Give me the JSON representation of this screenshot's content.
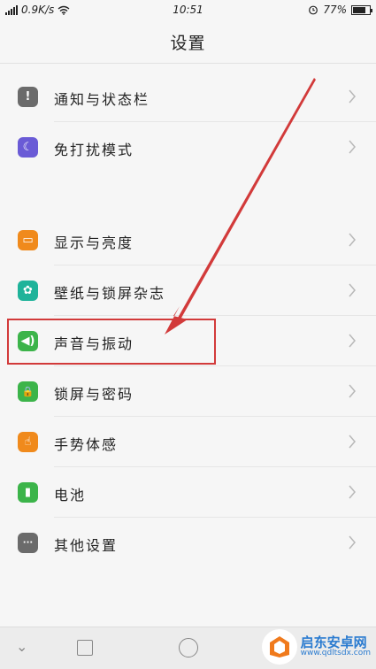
{
  "status_bar": {
    "speed": "0.9K/s",
    "time": "10:51",
    "battery_percent": "77%",
    "battery_level": 0.77,
    "icons": [
      "signal-icon",
      "wifi-icon",
      "alarm-icon",
      "battery-icon"
    ]
  },
  "header": {
    "title": "设置"
  },
  "groups": [
    {
      "items": [
        {
          "label": "通知与状态栏",
          "icon": "exclamation-icon",
          "color": "#6b6b6b",
          "glyph": "!"
        },
        {
          "label": "免打扰模式",
          "icon": "moon-icon",
          "color": "#6a5bd6",
          "glyph": "☾"
        }
      ]
    },
    {
      "items": [
        {
          "label": "显示与亮度",
          "icon": "display-icon",
          "color": "#f08a1c",
          "glyph": "▭"
        },
        {
          "label": "壁纸与锁屏杂志",
          "icon": "flower-icon",
          "color": "#1fb39a",
          "glyph": "✿"
        },
        {
          "label": "声音与振动",
          "icon": "speaker-icon",
          "color": "#3cb44a",
          "glyph": "◀)"
        },
        {
          "label": "锁屏与密码",
          "icon": "lock-icon",
          "color": "#3cb44a",
          "glyph": "🔒"
        },
        {
          "label": "手势体感",
          "icon": "hand-icon",
          "color": "#f08a1c",
          "glyph": "☝"
        },
        {
          "label": "电池",
          "icon": "battery-small-icon",
          "color": "#3cb44a",
          "glyph": "▮"
        },
        {
          "label": "其他设置",
          "icon": "more-icon",
          "color": "#6b6b6b",
          "glyph": "···"
        }
      ]
    }
  ],
  "watermark": {
    "title": "启东安卓网",
    "url": "www.qdltsdx.com"
  },
  "colors": {
    "highlight": "#d23a3a",
    "arrow": "#d23a3a"
  }
}
